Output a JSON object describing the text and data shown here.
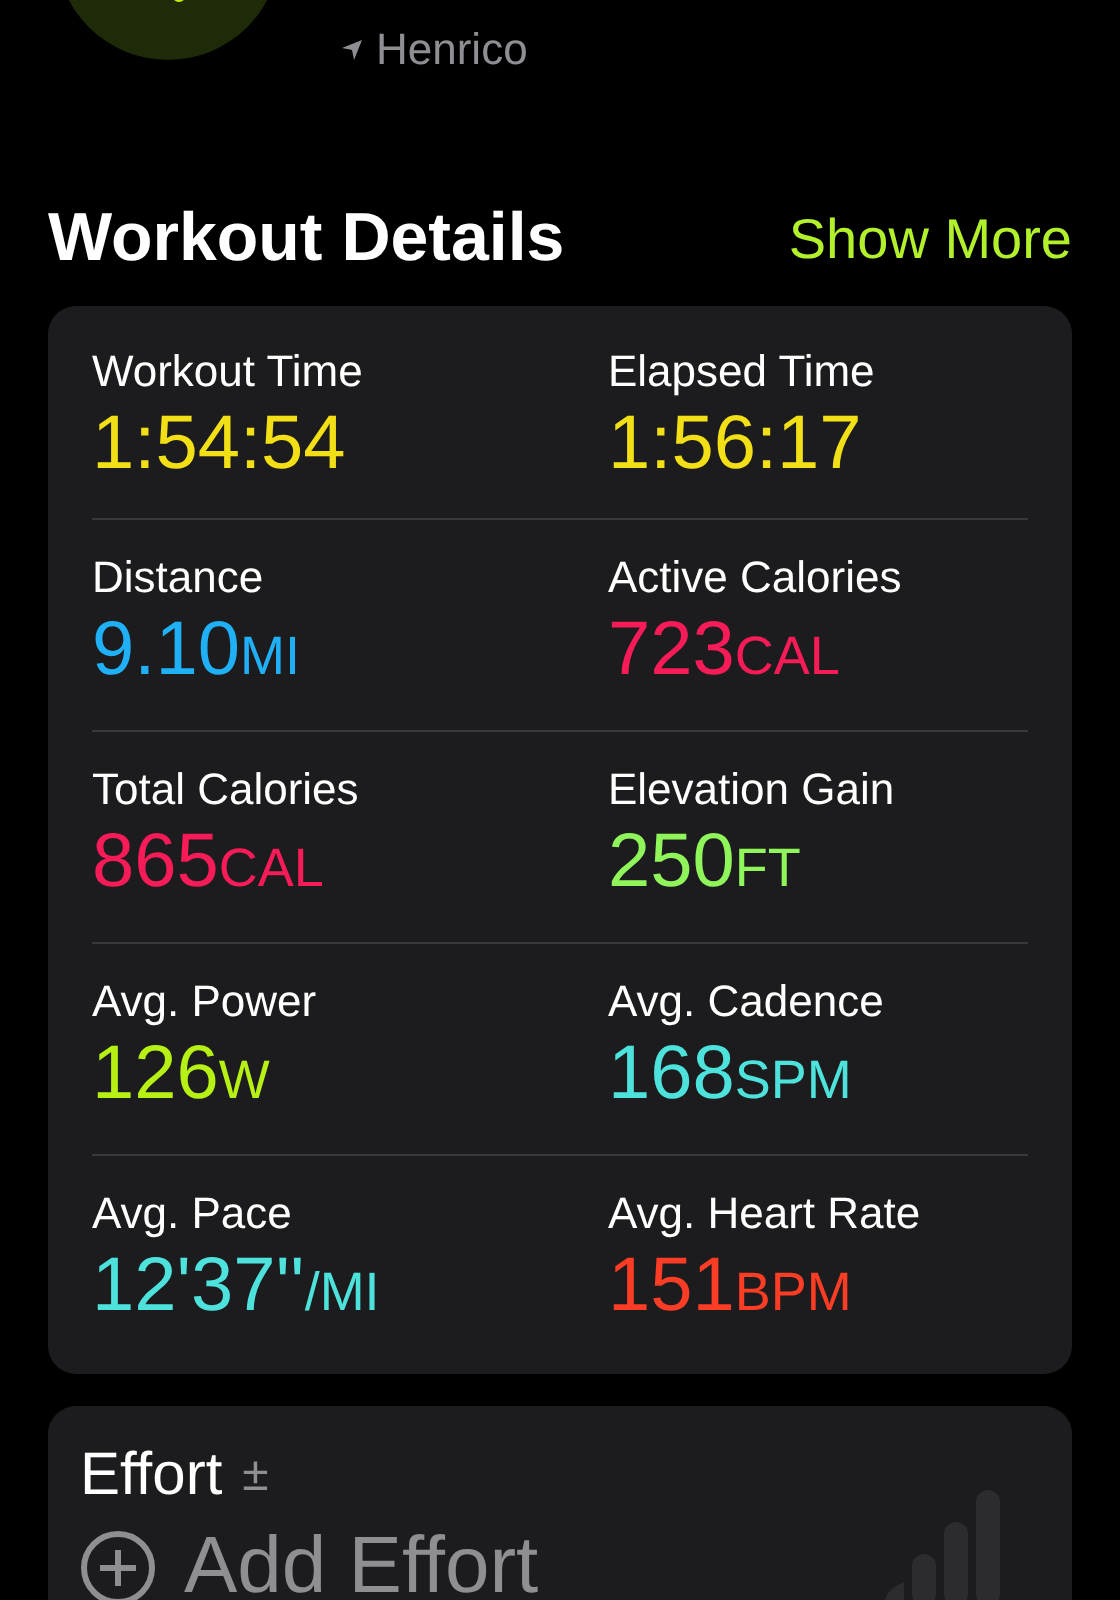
{
  "header": {
    "location": "Henrico"
  },
  "section": {
    "title": "Workout Details",
    "action": "Show More"
  },
  "metrics": [
    {
      "label": "Workout Time",
      "value": "1:54:54",
      "color": "#f2df16"
    },
    {
      "label": "Elapsed Time",
      "value": "1:56:17",
      "color": "#f2df16"
    },
    {
      "label": "Distance",
      "value": "9.10",
      "unit": "MI",
      "color": "#1fb0f5"
    },
    {
      "label": "Active Calories",
      "value": "723",
      "unit": "CAL",
      "color": "#f71b57"
    },
    {
      "label": "Total Calories",
      "value": "865",
      "unit": "CAL",
      "color": "#f71b57"
    },
    {
      "label": "Elevation Gain",
      "value": "250",
      "unit": "FT",
      "color": "#8ff55a"
    },
    {
      "label": "Avg. Power",
      "value": "126",
      "unit": "W",
      "color": "#b6f014"
    },
    {
      "label": "Avg. Cadence",
      "value": "168",
      "unit": "SPM",
      "color": "#4ee2dc"
    },
    {
      "label": "Avg. Pace",
      "value": "12'37''",
      "unit": "/MI",
      "color": "#4ee2dc"
    },
    {
      "label": "Avg. Heart Rate",
      "value": "151",
      "unit": "BPM",
      "color": "#fa3d24"
    }
  ],
  "effort": {
    "title": "Effort",
    "symbol": "±",
    "action": "Add Effort"
  }
}
